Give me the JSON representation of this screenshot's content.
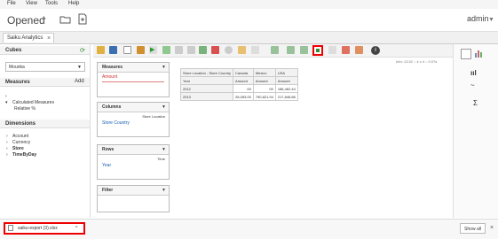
{
  "menu": {
    "file": "File",
    "view": "View",
    "tools": "Tools",
    "help": "Help"
  },
  "header": {
    "title": "Opened",
    "user": "admin"
  },
  "tab": {
    "label": "Saiku Analytics"
  },
  "sidebar": {
    "cubes_label": "Cubes",
    "cube_selected": "Mounka",
    "measures_label": "Measures",
    "add_label": "Add",
    "calculated_measures": "Calculated Measures",
    "relative": "Relative %",
    "dimensions_label": "Dimensions",
    "dimensions": [
      "Account",
      "Currency",
      "Store",
      "TimeByDay"
    ]
  },
  "drop_zones": {
    "measures": {
      "title": "Measures",
      "item": "Amount"
    },
    "columns": {
      "title": "Columns",
      "header": "Store Location",
      "item": "Store Country"
    },
    "rows": {
      "title": "Rows",
      "header": "Time",
      "item": "Year"
    },
    "filter": {
      "title": "Filter"
    }
  },
  "info": "Info: 13.52 :: 4 x 4 :: 0.07s",
  "grid": {
    "corner": "Store Location - Store Country",
    "columns": [
      "Canada",
      "Mexico",
      "USA"
    ],
    "row_header": "Year",
    "measure": "Amount",
    "rows": [
      {
        "year": "2012",
        "values": [
          "00",
          "00",
          "186,462.44"
        ]
      },
      {
        "year": "2013",
        "values": [
          "28,053.00",
          "790,821.94",
          "217,848.86"
        ]
      }
    ]
  },
  "bottom": {
    "download": "saiku-export (3).xlsx",
    "show_all": "Show all"
  },
  "colors": {
    "highlight": "#e00000",
    "link": "#1a5fb4"
  }
}
